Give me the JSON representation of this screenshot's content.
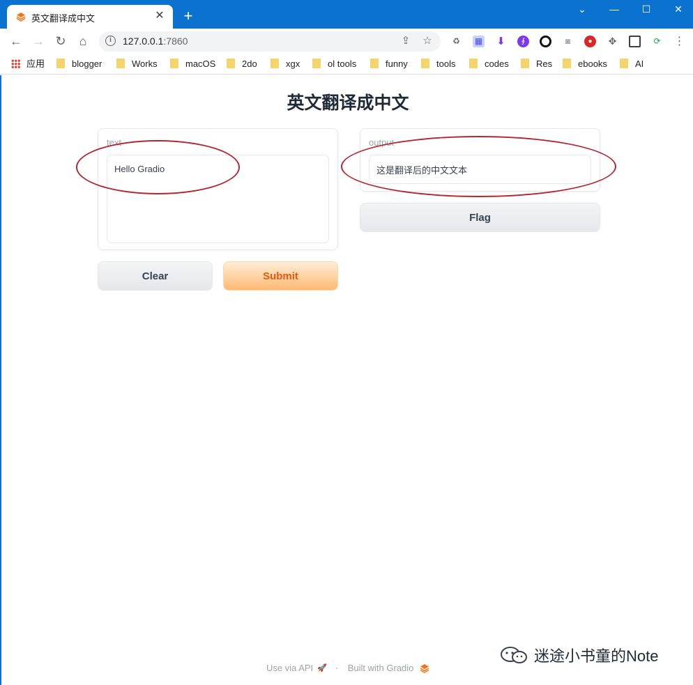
{
  "browser": {
    "tab_title": "英文翻译成中文",
    "url_host": "127.0.0.1",
    "url_port": ":7860",
    "window_controls": [
      "chevron-down-icon",
      "minimize-icon",
      "maximize-icon",
      "close-icon"
    ]
  },
  "bookmarks": [
    {
      "label": "应用",
      "icon": "apps-grid-icon"
    },
    {
      "label": "blogger"
    },
    {
      "label": "Works"
    },
    {
      "label": "macOS"
    },
    {
      "label": "2do"
    },
    {
      "label": "xgx"
    },
    {
      "label": "ol tools"
    },
    {
      "label": "funny"
    },
    {
      "label": "tools"
    },
    {
      "label": "codes"
    },
    {
      "label": "Res"
    },
    {
      "label": "ebooks"
    },
    {
      "label": "AI"
    }
  ],
  "app": {
    "title": "英文翻译成中文",
    "input": {
      "label": "text",
      "value": "Hello Gradio"
    },
    "output": {
      "label": "output",
      "value": "这是翻译后的中文文本"
    },
    "buttons": {
      "clear": "Clear",
      "submit": "Submit",
      "flag": "Flag"
    }
  },
  "footer": {
    "api_link": "Use via API",
    "separator": "·",
    "built_with": "Built with Gradio"
  },
  "watermark": {
    "text": "迷途小书童的Note"
  },
  "colors": {
    "titlebar": "#0b73cf",
    "annotation": "#b3262f",
    "submit_text": "#ea580c"
  }
}
